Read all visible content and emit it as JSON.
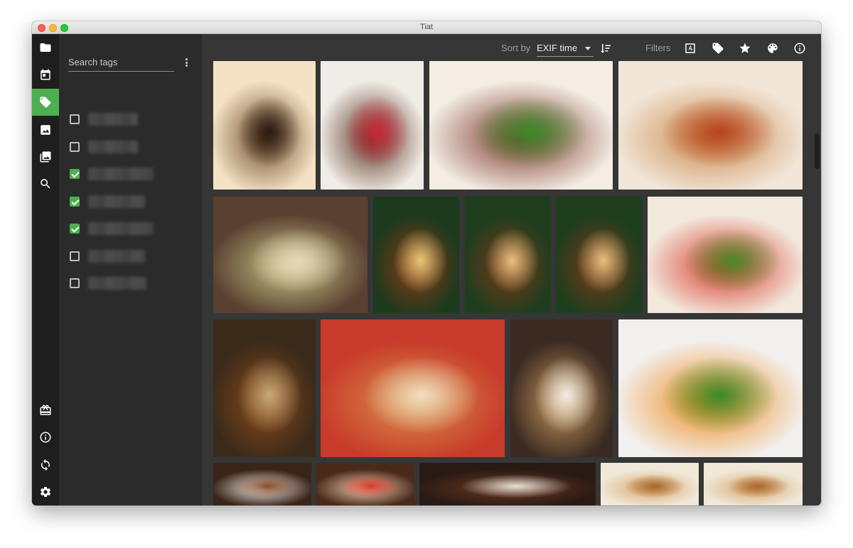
{
  "window": {
    "title": "Tiat"
  },
  "rail": {
    "top_items": [
      {
        "name": "folder-icon",
        "active": false
      },
      {
        "name": "calendar-icon",
        "active": false
      },
      {
        "name": "tag-icon",
        "active": true
      },
      {
        "name": "image-icon",
        "active": false
      },
      {
        "name": "gallery-icon",
        "active": false
      },
      {
        "name": "search-icon",
        "active": false
      }
    ],
    "bottom_items": [
      {
        "name": "gift-icon"
      },
      {
        "name": "info-icon"
      },
      {
        "name": "sync-icon"
      },
      {
        "name": "settings-icon"
      }
    ]
  },
  "tag_panel": {
    "search_placeholder": "Search tags",
    "tags": [
      {
        "checked": false,
        "label_redacted": true
      },
      {
        "checked": false,
        "label_redacted": true
      },
      {
        "checked": true,
        "label_redacted": true
      },
      {
        "checked": true,
        "label_redacted": true
      },
      {
        "checked": true,
        "label_redacted": true
      },
      {
        "checked": false,
        "label_redacted": true
      },
      {
        "checked": false,
        "label_redacted": true
      }
    ]
  },
  "toolbar": {
    "sort_label": "Sort by",
    "sort_value": "EXIF time",
    "filters_label": "Filters",
    "filter_icons": [
      "text-filter-icon",
      "tag-filter-icon",
      "star-filter-icon",
      "palette-filter-icon",
      "info-filter-icon"
    ]
  },
  "photos": [
    {
      "subject": "coffee-cup",
      "colors": [
        "#f4e2c4",
        "#6b4a2a",
        "#2a1a10"
      ]
    },
    {
      "subject": "chocolate-cake-fruit",
      "colors": [
        "#f0ece6",
        "#5a3422",
        "#c8283a"
      ]
    },
    {
      "subject": "roast-beef",
      "colors": [
        "#f3ede4",
        "#7a3428",
        "#3c8a2a"
      ]
    },
    {
      "subject": "bread-tomato-sauce",
      "colors": [
        "#f2e6d8",
        "#c88a4a",
        "#b8421e"
      ]
    },
    {
      "subject": "green-soup",
      "colors": [
        "#5a4030",
        "#c8c88a",
        "#e8d8b8"
      ]
    },
    {
      "subject": "beer-bottles",
      "colors": [
        "#1c3a1c",
        "#8a3a18",
        "#e8c878"
      ]
    },
    {
      "subject": "beer-glass",
      "colors": [
        "#1e3e1e",
        "#7a3818",
        "#e8c080"
      ]
    },
    {
      "subject": "beer-glass-2",
      "colors": [
        "#1e3e1e",
        "#7a3818",
        "#e8c080"
      ]
    },
    {
      "subject": "salad-plate",
      "colors": [
        "#f2e8dc",
        "#d8382a",
        "#4a8a2a"
      ]
    },
    {
      "subject": "beer-table",
      "colors": [
        "#3a2a1a",
        "#8a4a18",
        "#c8a878"
      ]
    },
    {
      "subject": "bread-basket",
      "colors": [
        "#c83a2a",
        "#d8904a",
        "#f0e0c0"
      ]
    },
    {
      "subject": "ice-cream-toast",
      "colors": [
        "#3a2a22",
        "#c8985a",
        "#f2ece4"
      ]
    },
    {
      "subject": "egg-salad",
      "colors": [
        "#f2f0ee",
        "#f08a1a",
        "#3a8a2a"
      ]
    },
    {
      "subject": "milk-glass",
      "colors": [
        "#3a2418",
        "#f0ece8",
        "#8a4a2a"
      ]
    },
    {
      "subject": "dessert-plate",
      "colors": [
        "#4a2a1a",
        "#f0d0b8",
        "#d83a2a"
      ]
    },
    {
      "subject": "coffee-table",
      "colors": [
        "#2a1a14",
        "#6a3a22",
        "#e8e0d8"
      ]
    },
    {
      "subject": "pastry",
      "colors": [
        "#f0e8d8",
        "#d8a870",
        "#a8682a"
      ]
    },
    {
      "subject": "pastry-2",
      "colors": [
        "#f0e8d8",
        "#d8a870",
        "#a8682a"
      ]
    }
  ]
}
